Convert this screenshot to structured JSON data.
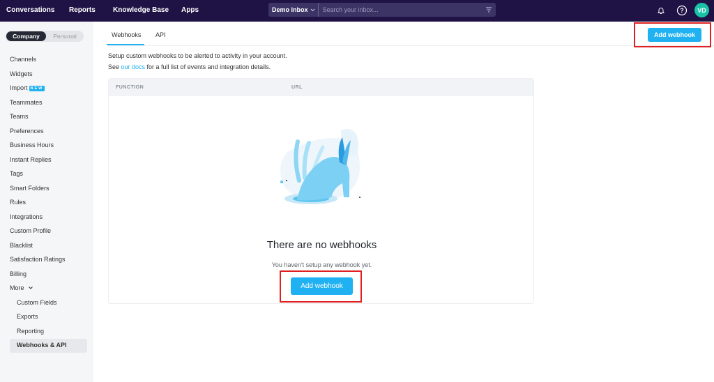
{
  "topnav": {
    "items": [
      "Conversations",
      "Reports",
      "Knowledge Base",
      "Apps"
    ],
    "inbox_label": "Demo Inbox",
    "search_placeholder": "Search your inbox...",
    "avatar_initials": "VD"
  },
  "sidebar": {
    "toggle_active": "Company",
    "toggle_inactive": "Personal",
    "items": [
      "Channels",
      "Widgets",
      "Import",
      "Teammates",
      "Teams",
      "Preferences",
      "Business Hours",
      "Instant Replies",
      "Tags",
      "Smart Folders",
      "Rules",
      "Integrations",
      "Custom Profile",
      "Blacklist",
      "Satisfaction Ratings",
      "Billing",
      "More"
    ],
    "import_badge": "NEW",
    "sub_items": [
      "Custom Fields",
      "Exports",
      "Reporting",
      "Webhooks & API"
    ]
  },
  "tabs": [
    "Webhooks",
    "API"
  ],
  "header_button": "Add webhook",
  "description": {
    "line1": "Setup custom webhooks to be alerted to activity in your account.",
    "line2_prefix": "See ",
    "docs_link": "our docs",
    "line2_suffix": " for a full list of events and integration details."
  },
  "table": {
    "columns": [
      "FUNCTION",
      "URL"
    ]
  },
  "empty_state": {
    "title": "There are no webhooks",
    "subtitle": "You haven't setup any webhook yet.",
    "button": "Add webhook"
  },
  "colors": {
    "topbar": "#1f1346",
    "accent": "#1fb1f1",
    "avatar": "#19c3a7",
    "highlight": "#e02020"
  }
}
